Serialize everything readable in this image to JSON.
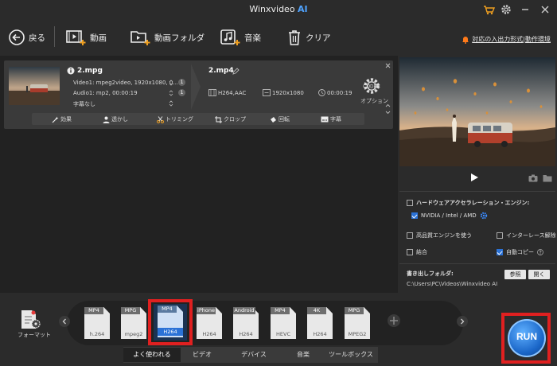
{
  "app": {
    "title_main": "Winxvideo",
    "title_ai": "AI"
  },
  "colors": {
    "accent": "#2b72d6",
    "highlight": "#e02020",
    "run": "#1a66c8",
    "help_icon": "#ff7a1a"
  },
  "toolbar": {
    "back": "戻る",
    "video": "動画",
    "folder": "動画フォルダ",
    "music": "音楽",
    "clear": "クリア",
    "help": "対応の入出力形式|動作環境"
  },
  "task": {
    "source_name": "2.mpg",
    "video_info": "Video1: mpeg2video, 1920x1080, 0...",
    "audio_info": "Audio1: mp2, 00:00:19",
    "subtitle": "字幕なし",
    "video_badge": "1",
    "audio_badge": "1",
    "output_name": "2.mp4",
    "codec": "H264,AAC",
    "resolution": "1920x1080",
    "duration": "00:00:19",
    "option_label": "オプション",
    "edit": [
      "効果",
      "透かし",
      "トリミング",
      "クロップ",
      "回転",
      "字幕"
    ]
  },
  "options": {
    "hw_title": "ハードウェアアクセラレーション・エンジン:",
    "hw_vendor": "NVIDIA / Intel / AMD",
    "high_quality": "高品質エンジンを使う",
    "deinterlace": "インターレース解除",
    "merge": "結合",
    "auto_copy": "自動コピー",
    "output_label": "書き出しフォルダ:",
    "output_path": "C:\\Users\\PC\\Videos\\Winxvideo AI",
    "browse": "参照",
    "open": "開く"
  },
  "formats": {
    "label": "フォーマット",
    "items": [
      {
        "top": "MP4",
        "bottom": "h.264",
        "selected": false
      },
      {
        "top": "MPG",
        "bottom": "mpeg2",
        "selected": false
      },
      {
        "top": "MP4",
        "bottom": "H264",
        "selected": true
      },
      {
        "top": "iPhone",
        "bottom": "H264",
        "selected": false
      },
      {
        "top": "Android",
        "bottom": "H264",
        "selected": false
      },
      {
        "top": "MP4",
        "bottom": "HEVC",
        "selected": false
      },
      {
        "top": "4K",
        "bottom": "H264",
        "selected": false
      },
      {
        "top": "MPG",
        "bottom": "MPEG2",
        "selected": false
      }
    ],
    "tabs": [
      "よく使われる",
      "ビデオ",
      "デバイス",
      "音楽",
      "ツールボックス"
    ]
  },
  "run_label": "RUN"
}
